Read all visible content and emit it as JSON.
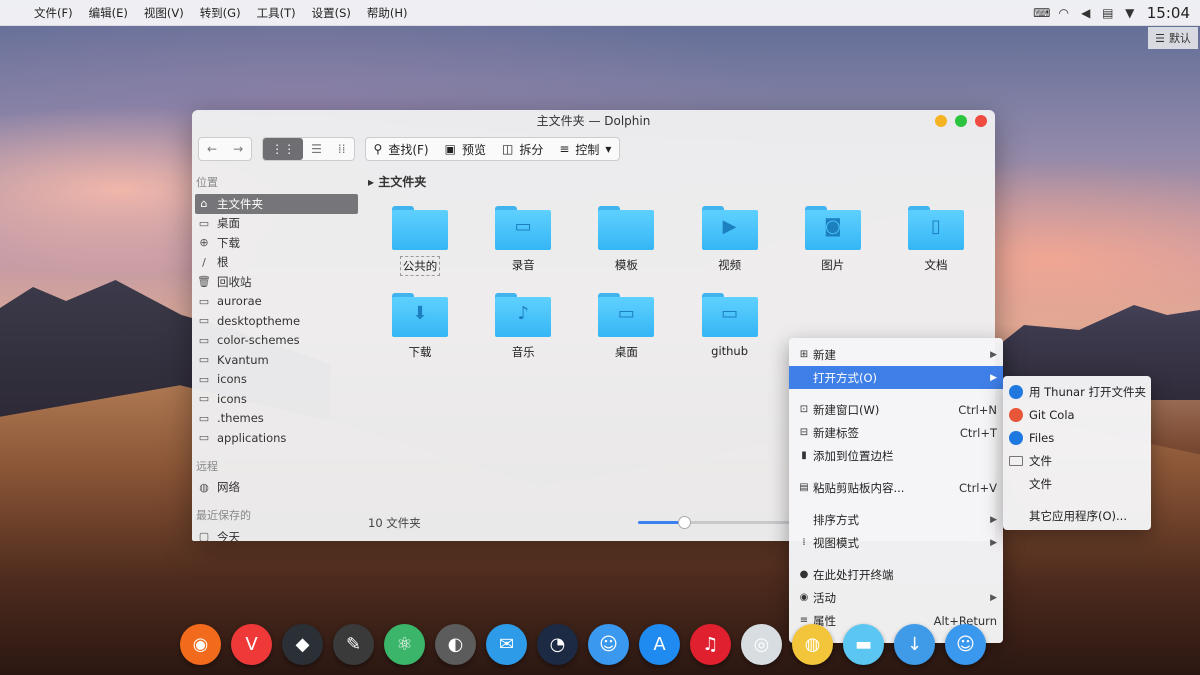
{
  "menubar": {
    "items": [
      "文件(F)",
      "编辑(E)",
      "视图(V)",
      "转到(G)",
      "工具(T)",
      "设置(S)",
      "帮助(H)"
    ],
    "clock": "15:04",
    "layout_badge": "默认"
  },
  "window": {
    "title": "主文件夹 — Dolphin",
    "toolbar": {
      "find": "查找(F)",
      "preview": "预览",
      "split": "拆分",
      "control": "控制"
    },
    "sidebar": {
      "section_places": "位置",
      "places": [
        {
          "label": "主文件夹",
          "icon": "home-icon"
        },
        {
          "label": "桌面",
          "icon": "desktop-icon"
        },
        {
          "label": "下载",
          "icon": "download-icon"
        },
        {
          "label": "根",
          "icon": "root-icon"
        },
        {
          "label": "回收站",
          "icon": "trash-icon"
        },
        {
          "label": "aurorae",
          "icon": "folder-icon"
        },
        {
          "label": "desktoptheme",
          "icon": "folder-icon"
        },
        {
          "label": "color-schemes",
          "icon": "folder-icon"
        },
        {
          "label": "Kvantum",
          "icon": "folder-icon"
        },
        {
          "label": "icons",
          "icon": "folder-icon"
        },
        {
          "label": "icons",
          "icon": "folder-icon"
        },
        {
          "label": ".themes",
          "icon": "folder-icon"
        },
        {
          "label": "applications",
          "icon": "folder-icon"
        }
      ],
      "section_remote": "远程",
      "remote": [
        {
          "label": "网络",
          "icon": "network-icon"
        }
      ],
      "section_recent": "最近保存的",
      "recent": [
        {
          "label": "今天",
          "icon": "calendar-icon"
        }
      ]
    },
    "breadcrumb": "主文件夹",
    "folders": [
      {
        "label": "公共的",
        "icon": "public-folder-icon"
      },
      {
        "label": "录音",
        "icon": "folder-icon"
      },
      {
        "label": "模板",
        "icon": "templates-folder-icon"
      },
      {
        "label": "视频",
        "icon": "video-folder-icon"
      },
      {
        "label": "图片",
        "icon": "pictures-folder-icon"
      },
      {
        "label": "文档",
        "icon": "documents-folder-icon"
      },
      {
        "label": "下载",
        "icon": "download-folder-icon"
      },
      {
        "label": "音乐",
        "icon": "music-folder-icon"
      },
      {
        "label": "桌面",
        "icon": "desktop-folder-icon"
      },
      {
        "label": "github",
        "icon": "folder-icon"
      }
    ],
    "status": "10 文件夹",
    "zoom_fraction": 0.27
  },
  "context_menu": {
    "items": [
      {
        "label": "新建",
        "shortcut": "",
        "submenu": true,
        "icon": "new-icon"
      },
      {
        "label": "打开方式(O)",
        "shortcut": "",
        "submenu": true,
        "icon": "",
        "highlighted": true
      },
      {
        "sep": true
      },
      {
        "label": "新建窗口(W)",
        "shortcut": "Ctrl+N",
        "icon": "new-window-icon"
      },
      {
        "label": "新建标签",
        "shortcut": "Ctrl+T",
        "icon": "new-tab-icon"
      },
      {
        "label": "添加到位置边栏",
        "shortcut": "",
        "icon": "bookmark-icon"
      },
      {
        "sep": true
      },
      {
        "label": "粘贴剪贴板内容...",
        "shortcut": "Ctrl+V",
        "icon": "paste-icon"
      },
      {
        "sep": true
      },
      {
        "label": "排序方式",
        "shortcut": "",
        "submenu": true,
        "icon": ""
      },
      {
        "label": "视图模式",
        "shortcut": "",
        "submenu": true,
        "icon": "view-mode-icon"
      },
      {
        "sep": true
      },
      {
        "label": "在此处打开终端",
        "shortcut": "",
        "icon": "terminal-icon"
      },
      {
        "label": "活动",
        "shortcut": "",
        "submenu": true,
        "icon": "activities-icon"
      },
      {
        "label": "属性",
        "shortcut": "Alt+Return",
        "icon": "properties-icon"
      }
    ]
  },
  "open_with_submenu": {
    "items": [
      {
        "label": "用 Thunar 打开文件夹",
        "icon": "thunar-icon",
        "color": "#1e78e0"
      },
      {
        "label": "Git Cola",
        "icon": "git-cola-icon",
        "color": "#e8563a"
      },
      {
        "label": "Files",
        "icon": "files-icon",
        "color": "#1e78e0"
      },
      {
        "label": "文件",
        "icon": "folder-icon",
        "color": ""
      },
      {
        "label": "文件",
        "icon": "",
        "color": ""
      },
      {
        "sep": true
      },
      {
        "label": "其它应用程序(O)...",
        "icon": "",
        "color": ""
      }
    ]
  },
  "dock": [
    {
      "name": "firefox-icon",
      "color": "#f26b1d",
      "glyph": "◉"
    },
    {
      "name": "vivaldi-icon",
      "color": "#ef3939",
      "glyph": "V"
    },
    {
      "name": "cube-icon",
      "color": "#2b2f36",
      "glyph": "◆"
    },
    {
      "name": "inkscape-icon",
      "color": "#3a3a3a",
      "glyph": "✎"
    },
    {
      "name": "atom-icon",
      "color": "#3bb56a",
      "glyph": "⚛"
    },
    {
      "name": "toggle-icon",
      "color": "#5c5c5c",
      "glyph": "◐"
    },
    {
      "name": "mail-icon",
      "color": "#2d9be8",
      "glyph": "✉"
    },
    {
      "name": "speedometer-icon",
      "color": "#1d2a44",
      "glyph": "◔"
    },
    {
      "name": "finder-icon",
      "color": "#3a98ef",
      "glyph": "☺"
    },
    {
      "name": "app-store-icon",
      "color": "#1f8af0",
      "glyph": "A"
    },
    {
      "name": "netease-music-icon",
      "color": "#e0202f",
      "glyph": "♫"
    },
    {
      "name": "camera-icon",
      "color": "#d8dde2",
      "glyph": "◎"
    },
    {
      "name": "chrome-icon",
      "color": "#f3c53a",
      "glyph": "◍"
    },
    {
      "name": "blue-folder-icon",
      "color": "#5bc6f2",
      "glyph": "▬"
    },
    {
      "name": "downloader-icon",
      "color": "#3f9ae8",
      "glyph": "↓"
    },
    {
      "name": "finder-icon-2",
      "color": "#3a98ef",
      "glyph": "☺"
    }
  ]
}
